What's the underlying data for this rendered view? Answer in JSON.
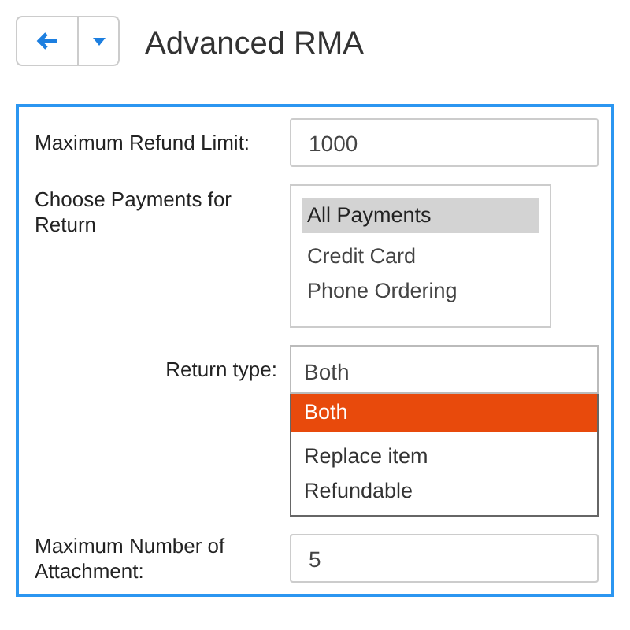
{
  "header": {
    "title": "Advanced RMA"
  },
  "form": {
    "fields": [
      {
        "kind": "text",
        "label": "Maximum Refund Limit:",
        "value": "1000"
      },
      {
        "kind": "multiselect",
        "label": "Choose Payments for Return",
        "options": [
          {
            "label": "All Payments",
            "selected": true
          },
          {
            "label": "Credit Card",
            "selected": false
          },
          {
            "label": "Phone Ordering",
            "selected": false
          }
        ]
      },
      {
        "kind": "dropdown",
        "label": "Return type:",
        "value": "Both",
        "expanded": true,
        "options": [
          {
            "label": "Both",
            "selected": true
          },
          {
            "label": "Replace item",
            "selected": false
          },
          {
            "label": "Refundable",
            "selected": false
          }
        ]
      },
      {
        "kind": "text",
        "label": "Maximum Number of Attachment:",
        "value": "5"
      }
    ]
  }
}
